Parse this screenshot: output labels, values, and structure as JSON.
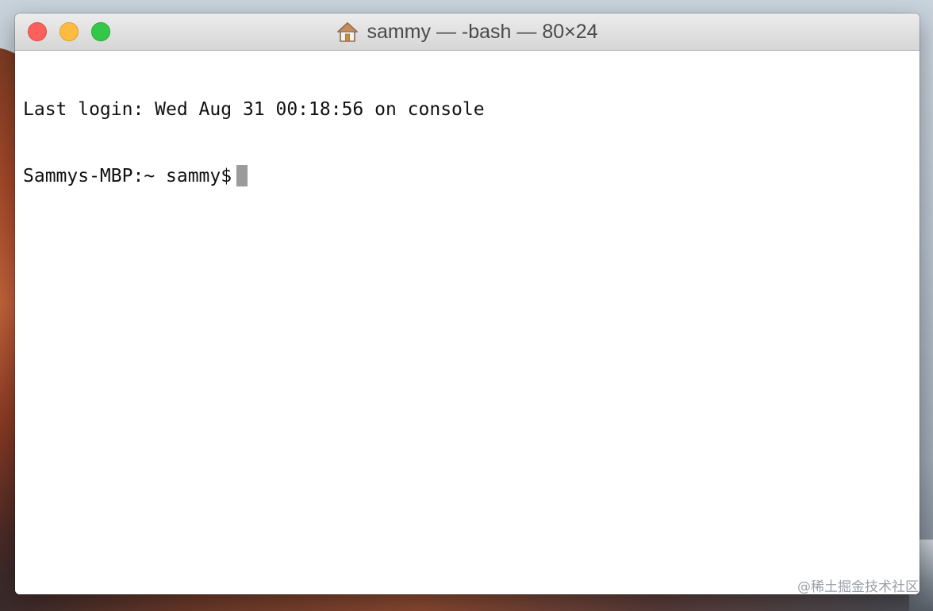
{
  "window": {
    "title": "sammy — -bash — 80×24",
    "icon": "home-folder-icon"
  },
  "terminal": {
    "lines": [
      "Last login: Wed Aug 31 00:18:56 on console",
      "Sammys-MBP:~ sammy$"
    ]
  },
  "watermark": "@稀土掘金技术社区",
  "colors": {
    "close": "#fc605c",
    "minimize": "#fdbc40",
    "zoom": "#34c84a",
    "cursor": "#9b9b9b"
  }
}
